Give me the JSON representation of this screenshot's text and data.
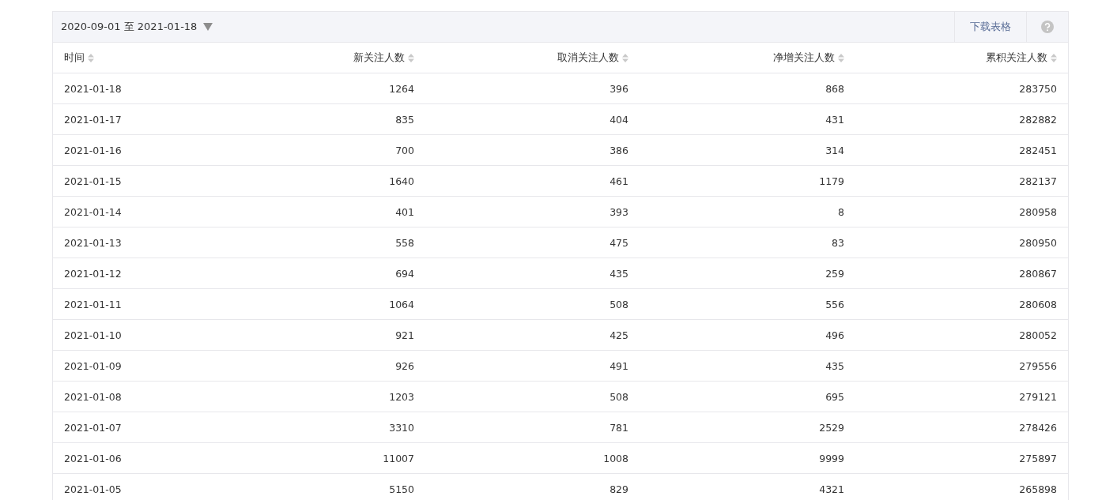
{
  "toolbar": {
    "date_range": "2020-09-01 至 2021-01-18",
    "download_button": "下载表格"
  },
  "table": {
    "columns": [
      "时间",
      "新关注人数",
      "取消关注人数",
      "净增关注人数",
      "累积关注人数"
    ],
    "rows": [
      [
        "2021-01-18",
        "1264",
        "396",
        "868",
        "283750"
      ],
      [
        "2021-01-17",
        "835",
        "404",
        "431",
        "282882"
      ],
      [
        "2021-01-16",
        "700",
        "386",
        "314",
        "282451"
      ],
      [
        "2021-01-15",
        "1640",
        "461",
        "1179",
        "282137"
      ],
      [
        "2021-01-14",
        "401",
        "393",
        "8",
        "280958"
      ],
      [
        "2021-01-13",
        "558",
        "475",
        "83",
        "280950"
      ],
      [
        "2021-01-12",
        "694",
        "435",
        "259",
        "280867"
      ],
      [
        "2021-01-11",
        "1064",
        "508",
        "556",
        "280608"
      ],
      [
        "2021-01-10",
        "921",
        "425",
        "496",
        "280052"
      ],
      [
        "2021-01-09",
        "926",
        "491",
        "435",
        "279556"
      ],
      [
        "2021-01-08",
        "1203",
        "508",
        "695",
        "279121"
      ],
      [
        "2021-01-07",
        "3310",
        "781",
        "2529",
        "278426"
      ],
      [
        "2021-01-06",
        "11007",
        "1008",
        "9999",
        "275897"
      ],
      [
        "2021-01-05",
        "5150",
        "829",
        "4321",
        "265898"
      ]
    ]
  }
}
